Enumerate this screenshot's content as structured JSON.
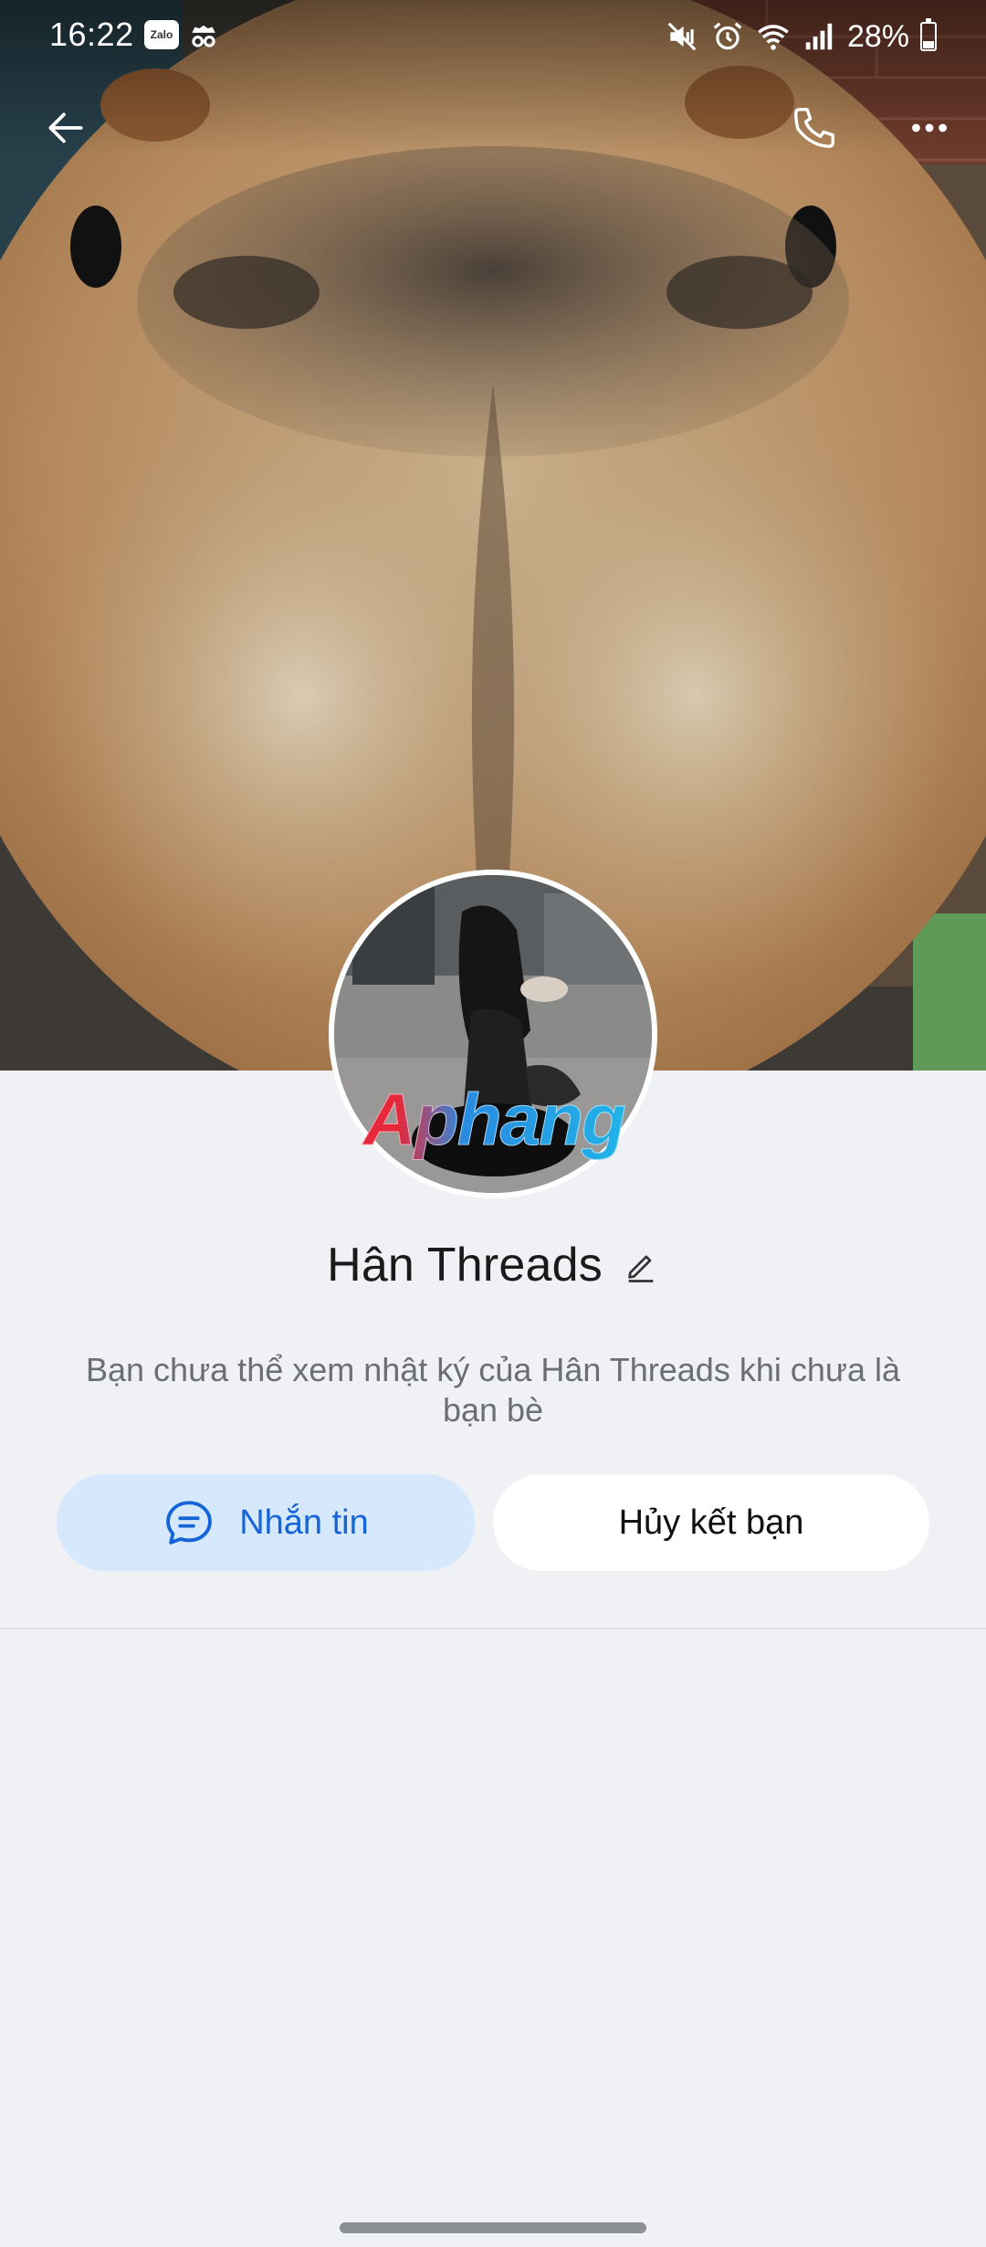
{
  "status_bar": {
    "time": "16:22",
    "notification_icons": [
      "zalo-app-icon",
      "incognito-icon"
    ],
    "zalo_label": "Zalo",
    "system_icons": [
      "mute-icon",
      "alarm-icon",
      "wifi-icon",
      "signal-icon"
    ],
    "battery_percent": "28%",
    "battery_level": 0.28
  },
  "header": {
    "icons": [
      "back-arrow-icon",
      "phone-call-icon",
      "more-options-icon"
    ]
  },
  "profile": {
    "name": "Hân Threads",
    "edit_icon": "pencil-edit-icon",
    "watermark": "Aphang",
    "privacy_note": "Bạn chưa thể xem nhật ký của Hân Threads khi chưa là bạn bè"
  },
  "actions": {
    "message_label": "Nhắn tin",
    "message_icon": "chat-bubble-icon",
    "unfriend_label": "Hủy kết bạn"
  },
  "colors": {
    "background": "#f0f1f5",
    "message_button_bg": "#d6e8fc",
    "message_button_text": "#1565d8",
    "secondary_button_bg": "#ffffff",
    "muted_text": "#6b6e73"
  }
}
